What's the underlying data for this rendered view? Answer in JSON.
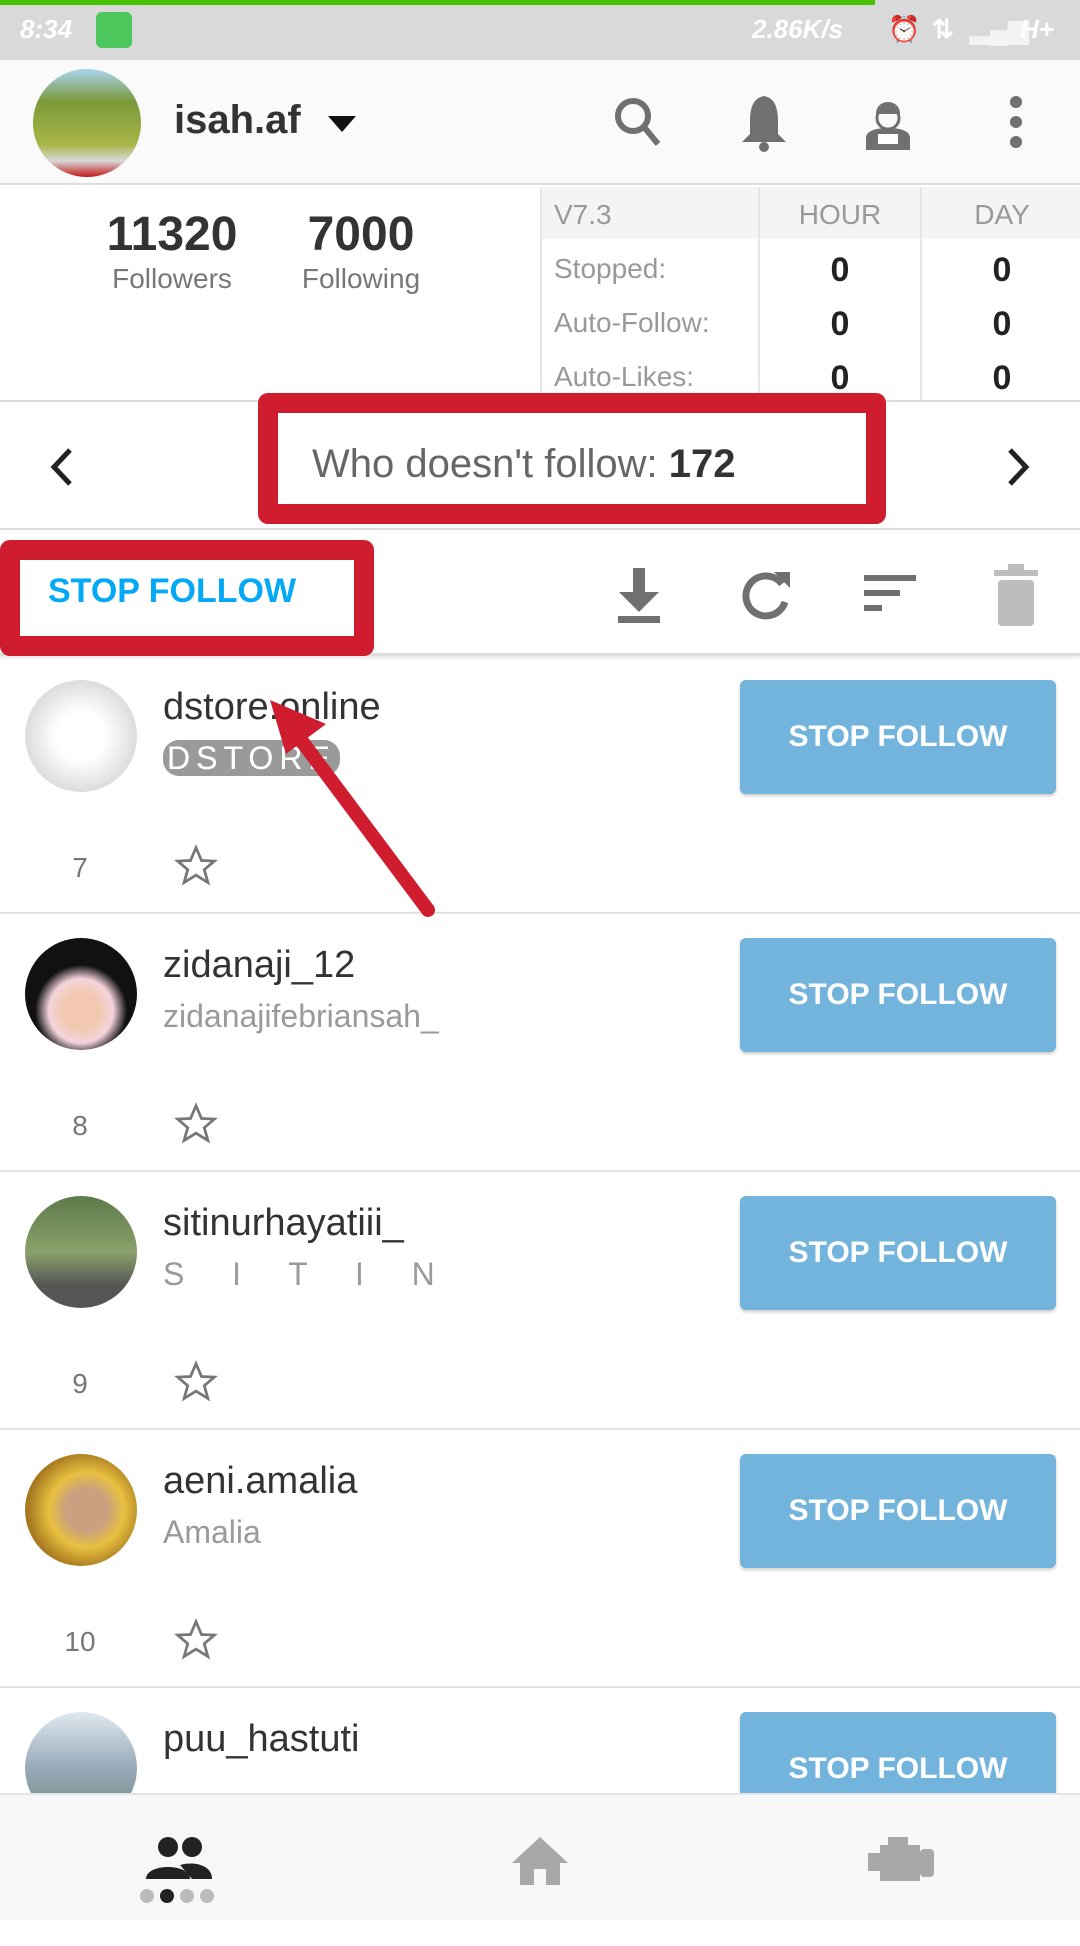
{
  "status_bar": {
    "time": "8:34",
    "net_speed": "2.86K/s",
    "network": "H+",
    "progress_percent": 81
  },
  "header": {
    "username": "isah.af"
  },
  "stats": {
    "followers": "11320",
    "followers_label": "Followers",
    "following": "7000",
    "following_label": "Following"
  },
  "table": {
    "version": "V7.3",
    "col_hour": "HOUR",
    "col_day": "DAY",
    "rows": [
      {
        "label": "Stopped:",
        "hour": "0",
        "day": "0"
      },
      {
        "label": "Auto-Follow:",
        "hour": "0",
        "day": "0"
      },
      {
        "label": "Auto-Likes:",
        "hour": "0",
        "day": "0"
      }
    ]
  },
  "nav": {
    "label": "Who doesn't follow:",
    "count": "172"
  },
  "toolbar": {
    "action": "STOP FOLLOW"
  },
  "items": [
    {
      "name": "dstore.online",
      "sub": "DSTORE",
      "num": "7",
      "button": "STOP FOLLOW"
    },
    {
      "name": "zidanaji_12",
      "sub": "zidanajifebriansah_",
      "num": "8",
      "button": "STOP FOLLOW"
    },
    {
      "name": "sitinurhayatiii_",
      "sub": "S  I  T  I  N",
      "num": "9",
      "button": "STOP FOLLOW"
    },
    {
      "name": "aeni.amalia",
      "sub": "Amalia",
      "num": "10",
      "button": "STOP FOLLOW"
    },
    {
      "name": "puu_hastuti",
      "sub": "",
      "num": "",
      "button": "STOP FOLLOW"
    }
  ],
  "colors": {
    "accent": "#03a9f4",
    "button": "#72b4dc",
    "annotation": "#d01c2f"
  }
}
